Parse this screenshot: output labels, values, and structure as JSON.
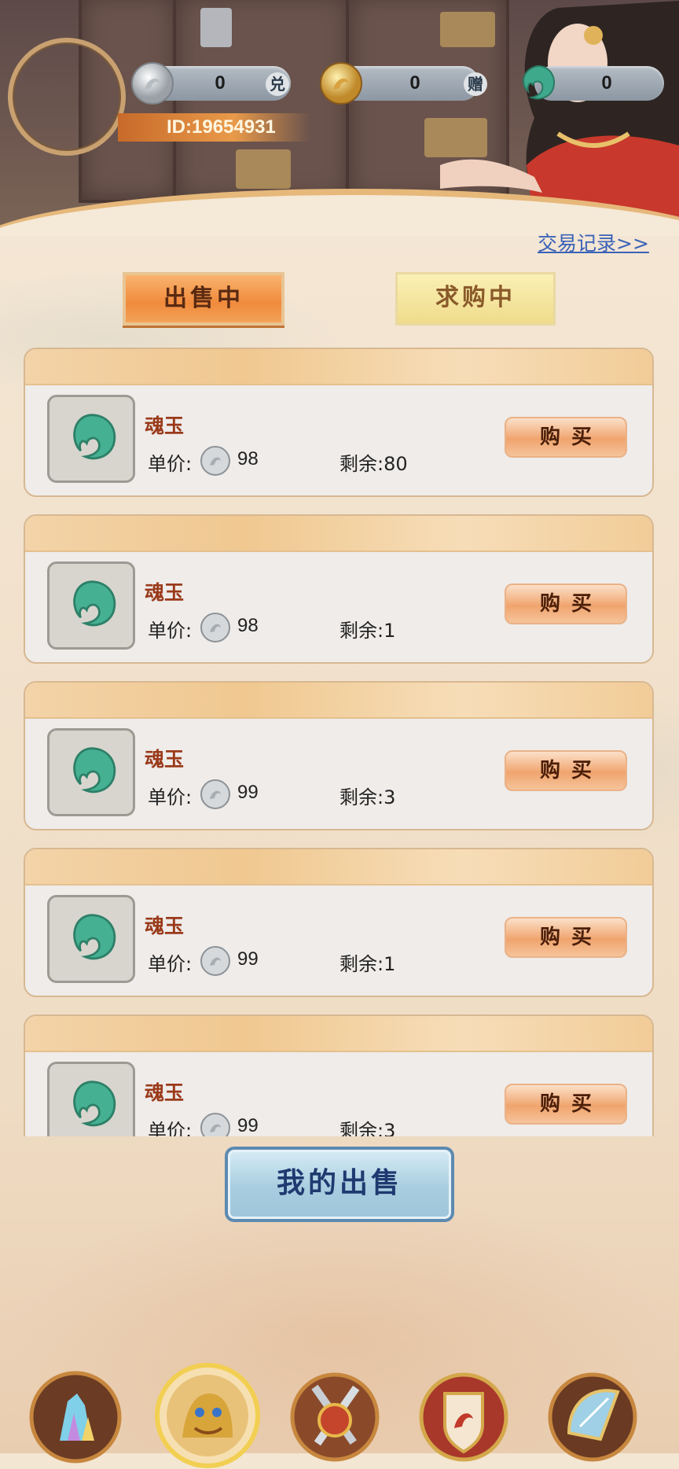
{
  "header": {
    "user_id": "ID:19654931",
    "currencies": [
      {
        "name": "silver-coin",
        "value": "0",
        "tag": "兑"
      },
      {
        "name": "gold-coin",
        "value": "0",
        "tag": "赠"
      },
      {
        "name": "jade",
        "value": "0"
      }
    ]
  },
  "record_link": "交易记录>>",
  "tabs": [
    {
      "label": "出售中",
      "active": true
    },
    {
      "label": "求购中",
      "active": false
    }
  ],
  "listings": [
    {
      "name": "魂玉",
      "price_label": "单价:",
      "price": "98",
      "remain": "剩余:80",
      "buy": "购买"
    },
    {
      "name": "魂玉",
      "price_label": "单价:",
      "price": "98",
      "remain": "剩余:1",
      "buy": "购买"
    },
    {
      "name": "魂玉",
      "price_label": "单价:",
      "price": "99",
      "remain": "剩余:3",
      "buy": "购买"
    },
    {
      "name": "魂玉",
      "price_label": "单价:",
      "price": "99",
      "remain": "剩余:1",
      "buy": "购买"
    },
    {
      "name": "魂玉",
      "price_label": "单价:",
      "price": "99",
      "remain": "剩余:3",
      "buy": "购买"
    }
  ],
  "my_sale_button": "我的出售",
  "bottom_nav": [
    {
      "icon": "crystal-icon"
    },
    {
      "icon": "lion-icon",
      "active": true
    },
    {
      "icon": "crossed-swords-icon"
    },
    {
      "icon": "dragon-shield-icon"
    },
    {
      "icon": "fan-icon"
    }
  ],
  "colors": {
    "accent_orange": "#f08a3c",
    "item_name": "#9a3a1a",
    "link_blue": "#3a62b8",
    "button_blue": "#a8cde0"
  }
}
